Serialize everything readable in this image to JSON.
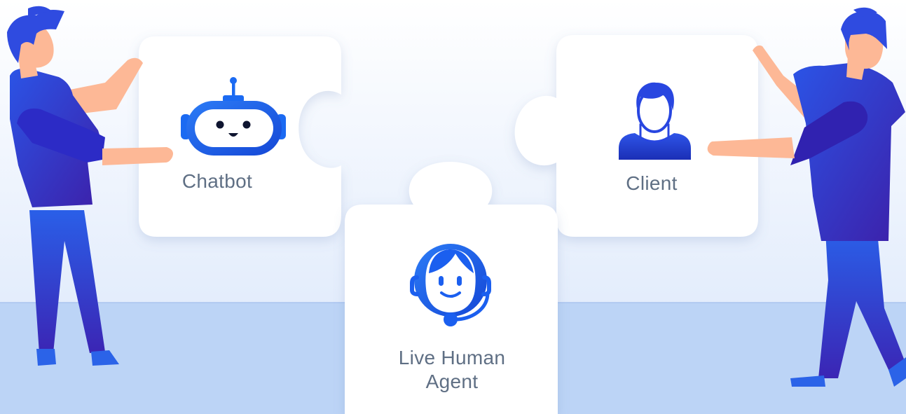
{
  "pieces": {
    "chatbot": {
      "label": "Chatbot",
      "icon": "robot-icon"
    },
    "client": {
      "label": "Client",
      "icon": "person-icon"
    },
    "agent": {
      "label": "Live Human Agent",
      "icon": "headset-agent-icon"
    }
  },
  "colors": {
    "background_top": "#ffffff",
    "background_bottom": "#d9e6fb",
    "floor": "#bcd4f6",
    "piece": "#ffffff",
    "label_text": "#5f6f84",
    "icon_blue": "#1b6af2",
    "figure_blue": "#2f37d8",
    "figure_dark": "#3a21a8",
    "skin": "#fdb896"
  }
}
